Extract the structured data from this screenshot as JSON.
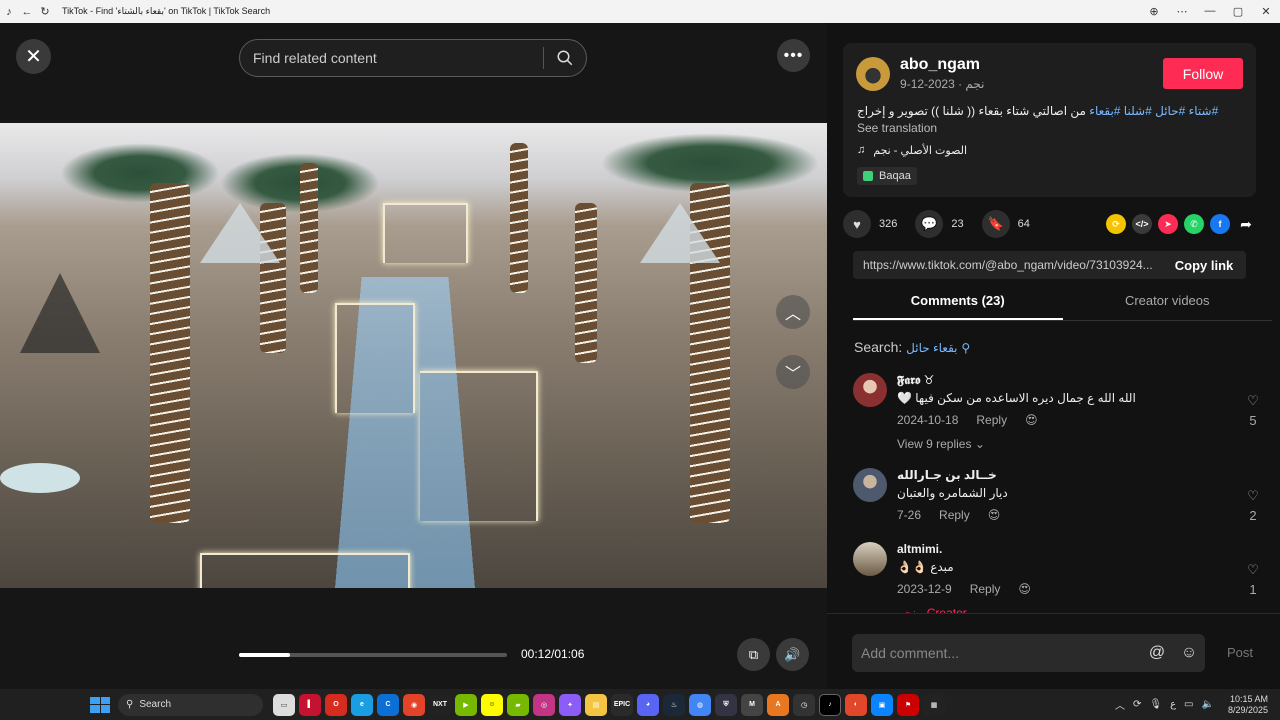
{
  "browser": {
    "title": "TikTok - Find 'بقعاء بالشتاء' on TikTok | TikTok Search"
  },
  "player": {
    "search_placeholder": "Find related content",
    "time": "00:12/01:06",
    "progress": 0.19
  },
  "post": {
    "author": "abo_ngam",
    "author_sub": "نجم · 2023-12-9",
    "follow_label": "Follow",
    "description_plain": "من اصالتي شتاء بقعاء (( شلنا )) تصوير و إخراج",
    "hashtags": "#شتاء #حائل #شلنا #بقعاء",
    "see_translation": "See translation",
    "music": "الصوت الأصلي - نجم",
    "location": "Baqaa"
  },
  "actions": {
    "likes": "326",
    "comments": "23",
    "saves": "64"
  },
  "share": {
    "url": "https://www.tiktok.com/@abo_ngam/video/73103924...",
    "copy_label": "Copy link"
  },
  "tabs": {
    "comments": "Comments (23)",
    "creator": "Creator videos"
  },
  "search": {
    "label": "Search:",
    "query": "بقعاء حائل"
  },
  "comments": [
    {
      "user": "𝕱𝖆𝖗𝖔 ♉",
      "text": "الله الله ع جمال ديره الاساعده من سكن فيها 🤍",
      "date": "2024-10-18",
      "reply": "Reply",
      "likes": "5",
      "replies": "View 9 replies"
    },
    {
      "user": "خــالد بن جـارالله",
      "text": "ديار الشمامره والعتبان",
      "date": "7-26",
      "reply": "Reply",
      "likes": "2"
    },
    {
      "user": "altmimi.",
      "text": "مبدع 👌🏻👌🏻",
      "date": "2023-12-9",
      "reply": "Reply",
      "likes": "1",
      "creator_reply": "نجم · Creator"
    }
  ],
  "comment_bar": {
    "placeholder": "Add comment...",
    "post_label": "Post"
  },
  "taskbar": {
    "search": "Search",
    "time": "10:15 AM",
    "date": "8/29/2025"
  },
  "colors": {
    "accent": "#fe2c55",
    "hashtag": "#7ab8ff",
    "bg": "#121212"
  }
}
